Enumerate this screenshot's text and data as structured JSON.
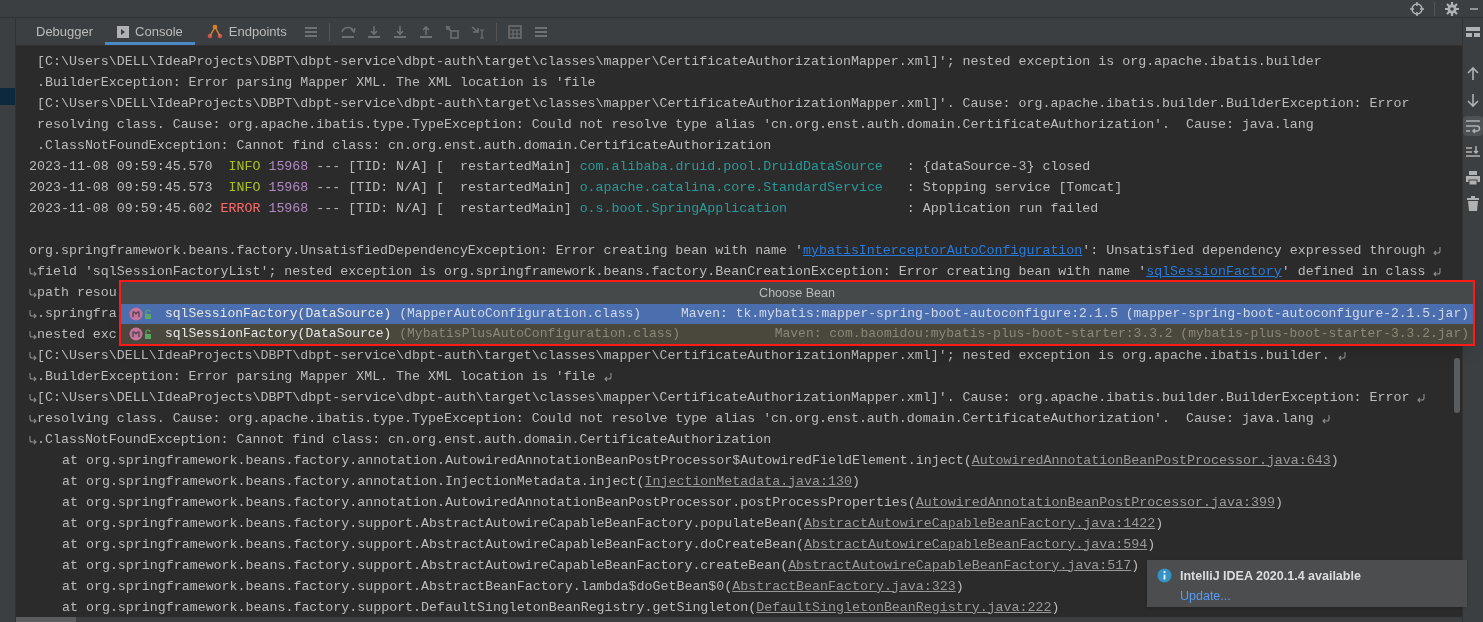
{
  "tabs": [
    {
      "label": "Debugger",
      "selected": false
    },
    {
      "label": "Console",
      "selected": true
    },
    {
      "label": "Endpoints",
      "selected": false
    }
  ],
  "console": {
    "lines": [
      {
        "kind": "continued",
        "segments": [
          {
            "kind": "plain",
            "text": "[C:\\Users\\DELL\\IdeaProjects\\DBPT\\dbpt-service\\dbpt-auth\\target\\classes\\mapper\\CertificateAuthorizationMapper.xml]'; nested exception is org.apache.ibatis.builder"
          }
        ]
      },
      {
        "kind": "continued",
        "segments": [
          {
            "kind": "plain",
            "text": ".BuilderException: Error parsing Mapper XML. The XML location is 'file"
          }
        ]
      },
      {
        "kind": "continued",
        "segments": [
          {
            "kind": "plain",
            "text": "[C:\\Users\\DELL\\IdeaProjects\\DBPT\\dbpt-service\\dbpt-auth\\target\\classes\\mapper\\CertificateAuthorizationMapper.xml]'. Cause: org.apache.ibatis.builder.BuilderException: Error"
          }
        ]
      },
      {
        "kind": "continued",
        "segments": [
          {
            "kind": "plain",
            "text": "resolving class. Cause: org.apache.ibatis.type.TypeException: Could not resolve type alias 'cn.org.enst.auth.domain.CertificateAuthorization'.  Cause: java.lang"
          }
        ]
      },
      {
        "kind": "continued",
        "segments": [
          {
            "kind": "plain",
            "text": ".ClassNotFoundException: Cannot find class: cn.org.enst.auth.domain.CertificateAuthorization"
          }
        ]
      },
      {
        "kind": "log",
        "segments": [
          {
            "kind": "plain",
            "text": "2023-11-08 09:59:45.570  "
          },
          {
            "kind": "info",
            "text": "INFO "
          },
          {
            "kind": "pid",
            "text": "15968"
          },
          {
            "kind": "plain",
            "text": " --- [TID: N/A] [  restartedMain] "
          },
          {
            "kind": "logger",
            "text": "com.alibaba.druid.pool.DruidDataSource"
          },
          {
            "kind": "plain",
            "text": "   : {dataSource-3} closed"
          }
        ]
      },
      {
        "kind": "log",
        "segments": [
          {
            "kind": "plain",
            "text": "2023-11-08 09:59:45.573  "
          },
          {
            "kind": "info",
            "text": "INFO "
          },
          {
            "kind": "pid",
            "text": "15968"
          },
          {
            "kind": "plain",
            "text": " --- [TID: N/A] [  restartedMain] "
          },
          {
            "kind": "logger",
            "text": "o.apache.catalina.core.StandardService"
          },
          {
            "kind": "plain",
            "text": "   : Stopping service [Tomcat]"
          }
        ]
      },
      {
        "kind": "log",
        "segments": [
          {
            "kind": "plain",
            "text": "2023-11-08 09:59:45.602 "
          },
          {
            "kind": "error",
            "text": "ERROR "
          },
          {
            "kind": "pid",
            "text": "15968"
          },
          {
            "kind": "plain",
            "text": " --- [TID: N/A] [  restartedMain] "
          },
          {
            "kind": "logger",
            "text": "o.s.boot.SpringApplication"
          },
          {
            "kind": "plain",
            "text": "               : Application run failed"
          }
        ]
      },
      {
        "kind": "blank"
      },
      {
        "kind": "log",
        "wrap_start": false,
        "wrap_end": true,
        "segments": [
          {
            "kind": "plain",
            "text": "org.springframework.beans.factory.UnsatisfiedDependencyException: Error creating bean with name '"
          },
          {
            "kind": "link",
            "text": "mybatisInterceptorAutoConfiguration"
          },
          {
            "kind": "plain",
            "text": "': Unsatisfied dependency expressed through"
          }
        ]
      },
      {
        "kind": "log",
        "wrap_start": true,
        "wrap_end": true,
        "segments": [
          {
            "kind": "plain",
            "text": "field 'sqlSessionFactoryList'; nested exception is org.springframework.beans.factory.BeanCreationException: Error creating bean with name '"
          },
          {
            "kind": "link",
            "text": "sqlSessionFactory"
          },
          {
            "kind": "plain",
            "text": "' defined in class"
          }
        ]
      },
      {
        "kind": "log",
        "wrap_start": true,
        "wrap_end": false,
        "segments": [
          {
            "kind": "plain",
            "text": "path resou"
          }
        ]
      },
      {
        "kind": "log",
        "wrap_start": true,
        "wrap_end": false,
        "segments": [
          {
            "kind": "plain",
            "text": ".springfra"
          }
        ]
      },
      {
        "kind": "log",
        "wrap_start": true,
        "wrap_end": false,
        "segments": [
          {
            "kind": "plain",
            "text": "nested exc"
          }
        ]
      },
      {
        "kind": "log",
        "wrap_start": true,
        "wrap_end": true,
        "segments": [
          {
            "kind": "plain",
            "text": "[C:\\Users\\DELL\\IdeaProjects\\DBPT\\dbpt-service\\dbpt-auth\\target\\classes\\mapper\\CertificateAuthorizationMapper.xml]'; nested exception is org.apache.ibatis.builder."
          }
        ]
      },
      {
        "kind": "log",
        "wrap_start": true,
        "wrap_end": true,
        "segments": [
          {
            "kind": "plain",
            "text": ".BuilderException: Error parsing Mapper XML. The XML location is 'file"
          }
        ]
      },
      {
        "kind": "log",
        "wrap_start": true,
        "wrap_end": true,
        "segments": [
          {
            "kind": "plain",
            "text": "[C:\\Users\\DELL\\IdeaProjects\\DBPT\\dbpt-service\\dbpt-auth\\target\\classes\\mapper\\CertificateAuthorizationMapper.xml]'. Cause: org.apache.ibatis.builder.BuilderException: Error"
          }
        ]
      },
      {
        "kind": "log",
        "wrap_start": true,
        "wrap_end": true,
        "segments": [
          {
            "kind": "plain",
            "text": "resolving class. Cause: org.apache.ibatis.type.TypeException: Could not resolve type alias 'cn.org.enst.auth.domain.CertificateAuthorization'.  Cause: java.lang"
          }
        ]
      },
      {
        "kind": "log",
        "wrap_start": true,
        "wrap_end": false,
        "segments": [
          {
            "kind": "plain",
            "text": ".ClassNotFoundException: Cannot find class: cn.org.enst.auth.domain.CertificateAuthorization"
          }
        ]
      },
      {
        "kind": "trace",
        "segments": [
          {
            "kind": "plain",
            "text": "at org.springframework.beans.factory.annotation.AutowiredAnnotationBeanPostProcessor$AutowiredFieldElement.inject("
          },
          {
            "kind": "source",
            "text": "AutowiredAnnotationBeanPostProcessor.java:643"
          },
          {
            "kind": "plain",
            "text": ")"
          }
        ]
      },
      {
        "kind": "trace",
        "segments": [
          {
            "kind": "plain",
            "text": "at org.springframework.beans.factory.annotation.InjectionMetadata.inject("
          },
          {
            "kind": "source",
            "text": "InjectionMetadata.java:130"
          },
          {
            "kind": "plain",
            "text": ")"
          }
        ]
      },
      {
        "kind": "trace",
        "segments": [
          {
            "kind": "plain",
            "text": "at org.springframework.beans.factory.annotation.AutowiredAnnotationBeanPostProcessor.postProcessProperties("
          },
          {
            "kind": "source",
            "text": "AutowiredAnnotationBeanPostProcessor.java:399"
          },
          {
            "kind": "plain",
            "text": ")"
          }
        ]
      },
      {
        "kind": "trace",
        "segments": [
          {
            "kind": "plain",
            "text": "at org.springframework.beans.factory.support.AbstractAutowireCapableBeanFactory.populateBean("
          },
          {
            "kind": "source",
            "text": "AbstractAutowireCapableBeanFactory.java:1422"
          },
          {
            "kind": "plain",
            "text": ")"
          }
        ]
      },
      {
        "kind": "trace",
        "segments": [
          {
            "kind": "plain",
            "text": "at org.springframework.beans.factory.support.AbstractAutowireCapableBeanFactory.doCreateBean("
          },
          {
            "kind": "source",
            "text": "AbstractAutowireCapableBeanFactory.java:594"
          },
          {
            "kind": "plain",
            "text": ")"
          }
        ]
      },
      {
        "kind": "trace",
        "segments": [
          {
            "kind": "plain",
            "text": "at org.springframework.beans.factory.support.AbstractAutowireCapableBeanFactory.createBean("
          },
          {
            "kind": "source",
            "text": "AbstractAutowireCapableBeanFactory.java:517"
          },
          {
            "kind": "plain",
            "text": ")"
          }
        ]
      },
      {
        "kind": "trace",
        "segments": [
          {
            "kind": "plain",
            "text": "at org.springframework.beans.factory.support.AbstractBeanFactory.lambda$doGetBean$0("
          },
          {
            "kind": "source",
            "text": "AbstractBeanFactory.java:323"
          },
          {
            "kind": "plain",
            "text": ")"
          }
        ]
      },
      {
        "kind": "trace",
        "segments": [
          {
            "kind": "plain",
            "text": "at org.springframework.beans.factory.support.DefaultSingletonBeanRegistry.getSingleton("
          },
          {
            "kind": "source",
            "text": "DefaultSingletonBeanRegistry.java:222"
          },
          {
            "kind": "plain",
            "text": ")"
          }
        ]
      }
    ]
  },
  "soft_wrap_on": true,
  "popup": {
    "title": "Choose Bean",
    "items": [
      {
        "method": "sqlSessionFactory(DataSource)",
        "config": "(MapperAutoConfiguration.class)",
        "source": "Maven: tk.mybatis:mapper-spring-boot-autoconfigure:2.1.5 (mapper-spring-boot-autoconfigure-2.1.5.jar)",
        "selected": true
      },
      {
        "method": "sqlSessionFactory(DataSource)",
        "config": "(MybatisPlusAutoConfiguration.class)",
        "source": "Maven: com.baomidou:mybatis-plus-boot-starter:3.3.2 (mybatis-plus-boot-starter-3.3.2.jar)",
        "selected": false
      }
    ]
  },
  "notification": {
    "title": "IntelliJ IDEA 2020.1.4 available",
    "link": "Update..."
  }
}
